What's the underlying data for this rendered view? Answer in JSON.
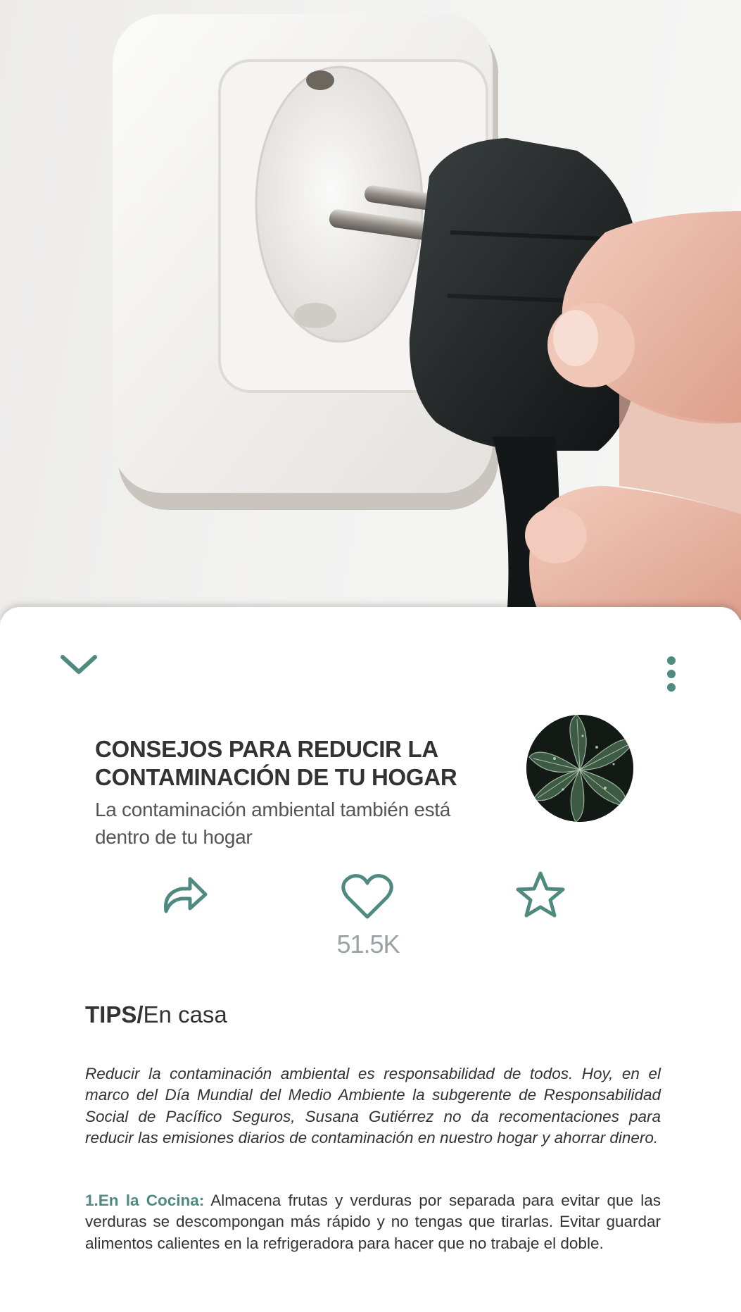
{
  "colors": {
    "accent": "#4e8a80",
    "title": "#333333",
    "subtitle": "#555555",
    "count": "#9aa3a4"
  },
  "hero": {
    "image": "wall-outlet-unplug-photo"
  },
  "toolbar": {
    "collapse_icon": "chevron-down-icon",
    "menu_icon": "more-vertical-icon"
  },
  "article": {
    "title_line1": "CONSEJOS PARA REDUCIR LA",
    "title_line2": "CONTAMINACIÓN DE TU HOGAR",
    "subtitle_line1": "La contaminación ambiental también está",
    "subtitle_line2": "dentro de tu hogar",
    "avatar_image": "green-leaves-thumbnail"
  },
  "actions": {
    "share_icon": "share-icon",
    "like_icon": "heart-icon",
    "favorite_icon": "star-icon",
    "likes_count": "51.5K"
  },
  "category": {
    "main": "TIPS/",
    "sub": "En casa"
  },
  "body": {
    "intro": "Reducir la contaminación ambiental es responsabilidad de todos. Hoy, en el marco del Día Mundial del Medio Ambiente la subgerente de Responsabilidad Social de Pacífico Seguros, Susana Gutiérrez no da recomentaciones para reducir las emisiones diarios de contaminación en nuestro hogar y ahorrar dinero.",
    "tip1_label": "1.En la Cocina:",
    "tip1_text": " Almacena frutas y verduras por separada para evitar que las verduras se descompongan más rápido y no tengas que tirarlas. Evitar guardar alimentos calientes en la refrigeradora para hacer que no trabaje el doble."
  }
}
